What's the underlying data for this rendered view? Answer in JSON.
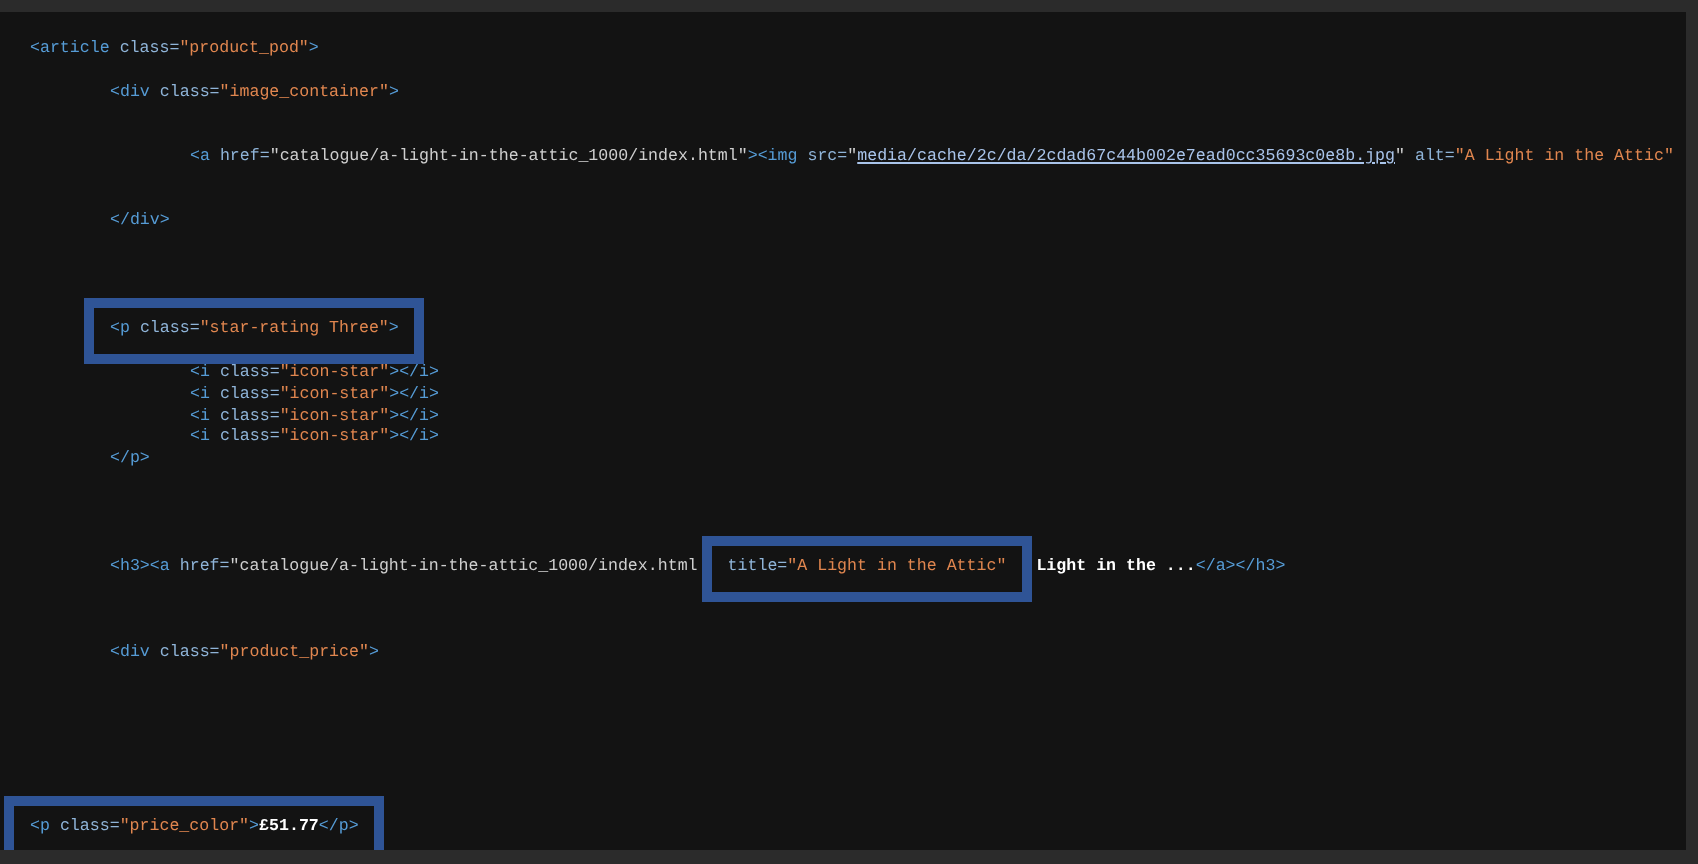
{
  "code_lines": [
    {
      "kind": "code",
      "tokens": [
        {
          "kind": "tag",
          "text": "<article "
        },
        {
          "kind": "attr",
          "text": "class="
        },
        {
          "kind": "string",
          "text": "\"product_pod\""
        },
        {
          "kind": "tag",
          "text": ">"
        }
      ],
      "children": [
        {
          "kind": "blank"
        },
        {
          "kind": "code",
          "tokens": [
            {
              "kind": "tag",
              "text": "<div "
            },
            {
              "kind": "attr",
              "text": "class="
            },
            {
              "kind": "string",
              "text": "\"image_container\""
            },
            {
              "kind": "tag",
              "text": ">"
            }
          ],
          "children": [
            {
              "kind": "blank"
            },
            {
              "kind": "blank"
            },
            {
              "kind": "code",
              "tokens": [
                {
                  "kind": "tag",
                  "text": "<a "
                },
                {
                  "kind": "attr",
                  "text": "href="
                },
                {
                  "kind": "url",
                  "text": "\"catalogue/a-light-in-the-attic_1000/index.html\""
                },
                {
                  "kind": "tag",
                  "text": "><img "
                },
                {
                  "kind": "attr",
                  "text": "src="
                },
                {
                  "kind": "url",
                  "text": "\""
                },
                {
                  "kind": "link",
                  "text": "media/cache/2c/da/2cdad67c44b002e7ead0cc35693c0e8b.jpg"
                },
                {
                  "kind": "url",
                  "text": "\" "
                },
                {
                  "kind": "attr",
                  "text": "alt="
                },
                {
                  "kind": "string",
                  "text": "\"A Light in the Attic\""
                }
              ]
            },
            {
              "kind": "blank"
            },
            {
              "kind": "blank"
            }
          ]
        },
        {
          "kind": "code",
          "tokens": [
            {
              "kind": "tag",
              "text": "</div>"
            }
          ]
        },
        {
          "kind": "blank"
        },
        {
          "kind": "blank"
        },
        {
          "kind": "blank"
        },
        {
          "kind": "blank"
        },
        {
          "kind": "code",
          "tokens": [
            {
              "kind": "highlight",
              "tokens": [
                {
                  "kind": "tag",
                  "text": "<p "
                },
                {
                  "kind": "attr",
                  "text": "class="
                },
                {
                  "kind": "string",
                  "text": "\"star-rating Three\""
                },
                {
                  "kind": "tag",
                  "text": ">"
                }
              ]
            }
          ],
          "children": [
            {
              "kind": "blank"
            },
            {
              "kind": "code",
              "tokens": [
                {
                  "kind": "tag",
                  "text": "<i "
                },
                {
                  "kind": "attr",
                  "text": "class="
                },
                {
                  "kind": "string",
                  "text": "\"icon-star\""
                },
                {
                  "kind": "tag",
                  "text": "></i>"
                }
              ]
            },
            {
              "kind": "code",
              "tokens": [
                {
                  "kind": "tag",
                  "text": "<i "
                },
                {
                  "kind": "attr",
                  "text": "class="
                },
                {
                  "kind": "string",
                  "text": "\"icon-star\""
                },
                {
                  "kind": "tag",
                  "text": "></i>"
                }
              ]
            },
            {
              "kind": "code",
              "tokens": [
                {
                  "kind": "tag",
                  "text": "<i "
                },
                {
                  "kind": "attr",
                  "text": "class="
                },
                {
                  "kind": "string",
                  "text": "\"icon-star\""
                },
                {
                  "kind": "tag",
                  "text": "></i>"
                }
              ]
            },
            {
              "kind": "code",
              "tokens": [
                {
                  "kind": "tag",
                  "text": "<i "
                },
                {
                  "kind": "attr",
                  "text": "class="
                },
                {
                  "kind": "string",
                  "text": "\"icon-star\""
                },
                {
                  "kind": "tag",
                  "text": "></i>"
                }
              ]
            }
          ]
        },
        {
          "kind": "code",
          "tokens": [
            {
              "kind": "tag",
              "text": "</p>"
            }
          ]
        },
        {
          "kind": "blank"
        },
        {
          "kind": "blank"
        },
        {
          "kind": "blank"
        },
        {
          "kind": "blank"
        },
        {
          "kind": "code",
          "tokens": [
            {
              "kind": "tag",
              "text": "<h3><a "
            },
            {
              "kind": "attr",
              "text": "href="
            },
            {
              "kind": "url",
              "text": "\"catalogue/a-light-in-the-attic_1000/index.html"
            },
            {
              "kind": "highlight",
              "tokens": [
                {
                  "kind": "attr",
                  "text": "title="
                },
                {
                  "kind": "string",
                  "text": "\"A Light in the Attic\""
                }
              ]
            },
            {
              "kind": "text",
              "text": "Light in the ..."
            },
            {
              "kind": "tag",
              "text": "</a></h3>"
            }
          ]
        },
        {
          "kind": "blank"
        },
        {
          "kind": "blank"
        },
        {
          "kind": "blank"
        },
        {
          "kind": "code",
          "tokens": [
            {
              "kind": "tag",
              "text": "<div "
            },
            {
              "kind": "attr",
              "text": "class="
            },
            {
              "kind": "string",
              "text": "\"product_price\""
            },
            {
              "kind": "tag",
              "text": ">"
            }
          ]
        },
        {
          "kind": "blank"
        },
        {
          "kind": "blank"
        },
        {
          "kind": "blank"
        },
        {
          "kind": "blank"
        },
        {
          "kind": "blank"
        },
        {
          "kind": "blank"
        },
        {
          "kind": "blank"
        }
      ]
    },
    {
      "kind": "code",
      "tokens": [
        {
          "kind": "highlight",
          "tokens": [
            {
              "kind": "tag",
              "text": "<p "
            },
            {
              "kind": "attr",
              "text": "class="
            },
            {
              "kind": "string",
              "text": "\"price_color\""
            },
            {
              "kind": "tag",
              "text": ">"
            },
            {
              "kind": "text",
              "text": "£51.77"
            },
            {
              "kind": "tag",
              "text": "</p>"
            }
          ]
        }
      ]
    }
  ]
}
